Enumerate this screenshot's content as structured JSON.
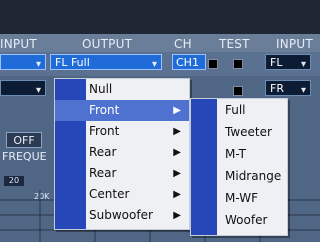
{
  "header": {
    "input_left": "INPUT",
    "output": "OUTPUT",
    "ch": "CH",
    "test": "TEST",
    "input_right": "INPUT"
  },
  "row1": {
    "output_value": "FL Full",
    "ch_value": "CH1",
    "right_input_value": "FL"
  },
  "row2": {
    "right_input_value": "FR"
  },
  "side": {
    "off_label": "OFF",
    "freq_label": "FREQUE",
    "small_value": "20",
    "small_20k": "20K"
  },
  "menu": {
    "items": [
      {
        "label": "Null",
        "has_submenu": false,
        "active": false
      },
      {
        "label": "Front",
        "has_submenu": true,
        "active": true
      },
      {
        "label": "Front",
        "has_submenu": true,
        "active": false
      },
      {
        "label": "Rear",
        "has_submenu": true,
        "active": false
      },
      {
        "label": "Rear",
        "has_submenu": true,
        "active": false
      },
      {
        "label": "Center",
        "has_submenu": true,
        "active": false
      },
      {
        "label": "Subwoofer",
        "has_submenu": true,
        "active": false
      }
    ],
    "submenu_items": [
      "Full",
      "Tweeter",
      "M-T",
      "Midrange",
      "M-WF",
      "Woofer"
    ]
  },
  "colors": {
    "accent": "#1f6bd7",
    "menu_gutter": "#2647b7",
    "menu_highlight": "#4f71d0",
    "panel_bg": "#4f6685",
    "menu_bg": "#eef0f4"
  },
  "icons": {
    "dropdown_caret": "caret-down-icon",
    "submenu_arrow": "chevron-right-icon",
    "test_box": "square-icon"
  }
}
